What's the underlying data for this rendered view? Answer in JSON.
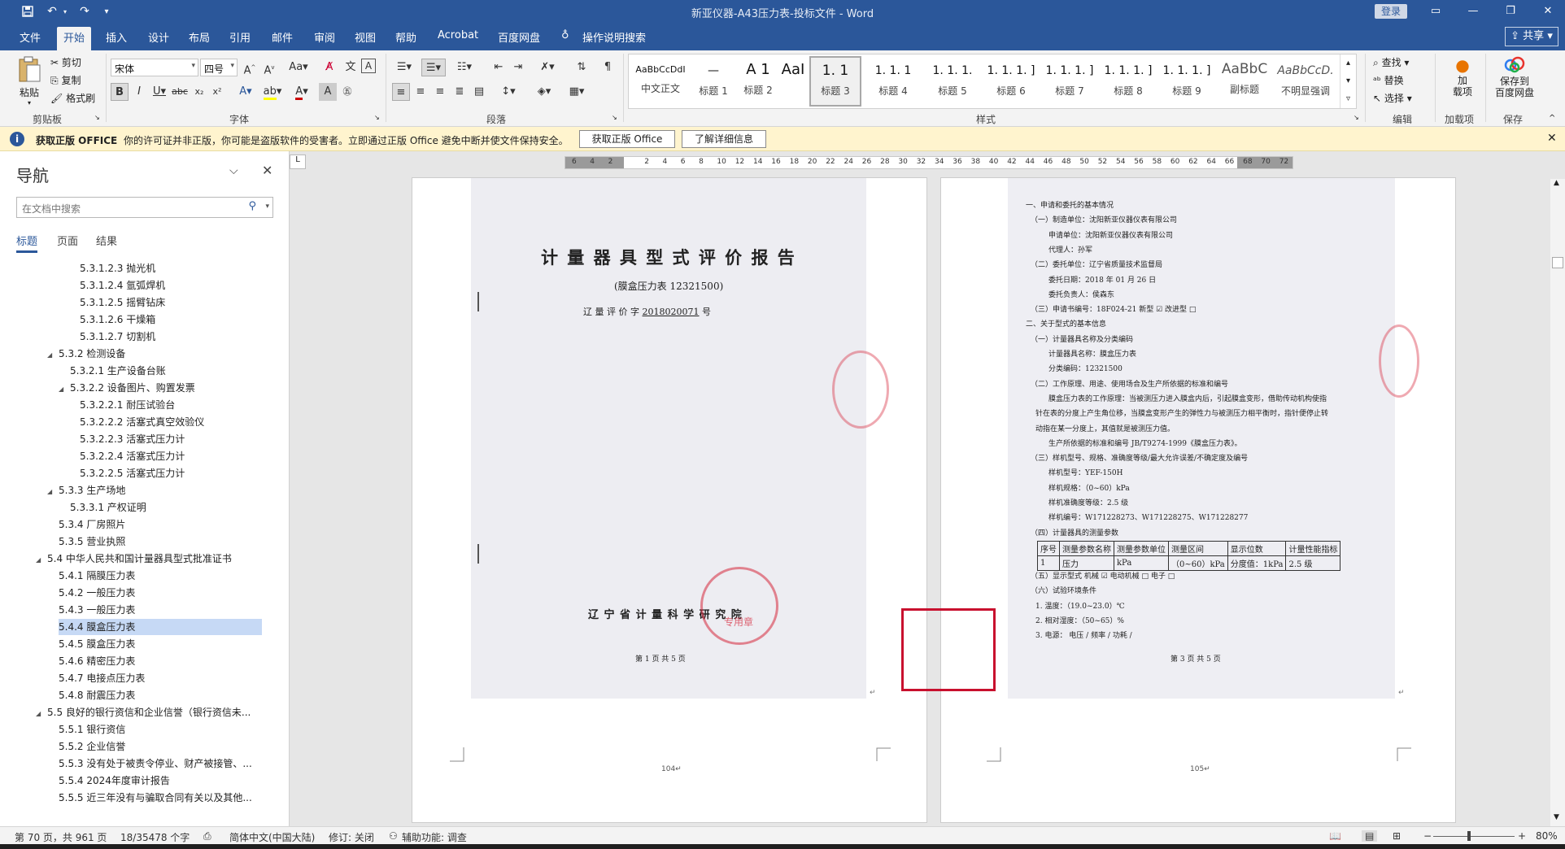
{
  "window": {
    "title": "新亚仪器-A43压力表-投标文件  -  Word",
    "login": "登录",
    "share": "共享"
  },
  "menu": [
    "文件",
    "开始",
    "插入",
    "设计",
    "布局",
    "引用",
    "邮件",
    "审阅",
    "视图",
    "帮助",
    "Acrobat",
    "百度网盘",
    "操作说明搜索"
  ],
  "ribbon": {
    "clipboard": {
      "paste": "粘贴",
      "cut": "剪切",
      "copy": "复制",
      "painter": "格式刷",
      "label": "剪贴板"
    },
    "font": {
      "name": "宋体",
      "size": "四号",
      "label": "字体"
    },
    "paragraph": {
      "label": "段落"
    },
    "styles": {
      "label": "样式",
      "items": [
        {
          "sample": "AaBbCcDdI",
          "name": "中文正文"
        },
        {
          "sample": "—",
          "name": "标题 1"
        },
        {
          "sample": "A  1",
          "name": "标题 2"
        },
        {
          "sample": "AaI",
          "name": ""
        },
        {
          "sample": "1. 1",
          "name": "标题 3"
        },
        {
          "sample": "1. 1. 1",
          "name": "标题 4"
        },
        {
          "sample": "1. 1. 1.",
          "name": "标题 5"
        },
        {
          "sample": "1. 1. 1. ]",
          "name": "标题 6"
        },
        {
          "sample": "1. 1. 1. ]",
          "name": "标题 7"
        },
        {
          "sample": "1. 1. 1. ]",
          "name": "标题 8"
        },
        {
          "sample": "1. 1. 1. ]",
          "name": "标题 9"
        },
        {
          "sample": "AaBbC",
          "name": "副标题"
        },
        {
          "sample": "AaBbCcD.",
          "name": "不明显强调"
        }
      ]
    },
    "editing": {
      "find": "查找",
      "replace": "替换",
      "select": "选择",
      "label": "编辑"
    },
    "addins": {
      "btn": "加\n载项",
      "label": "加载项"
    },
    "save": {
      "btn1": "保存到",
      "btn2": "百度网盘",
      "label": "保存"
    }
  },
  "infobar": {
    "title": "获取正版 OFFICE",
    "message": "你的许可证并非正版，你可能是盗版软件的受害者。立即通过正版 Office 避免中断并使文件保持安全。",
    "btn1": "获取正版 Office",
    "btn2": "了解详细信息"
  },
  "nav": {
    "title": "导航",
    "search_placeholder": "在文档中搜索",
    "tabs": [
      "标题",
      "页面",
      "结果"
    ],
    "items": [
      {
        "text": "5.3.1.2.3 抛光机",
        "level": 4
      },
      {
        "text": "5.3.1.2.4 氩弧焊机",
        "level": 4
      },
      {
        "text": "5.3.1.2.5 摇臂钻床",
        "level": 4
      },
      {
        "text": "5.3.1.2.6 干燥箱",
        "level": 4
      },
      {
        "text": "5.3.1.2.7 切割机",
        "level": 4
      },
      {
        "text": "5.3.2 检测设备",
        "level": 2,
        "expand": true
      },
      {
        "text": "5.3.2.1 生产设备台账",
        "level": 3
      },
      {
        "text": "5.3.2.2 设备图片、购置发票",
        "level": 3,
        "expand": true
      },
      {
        "text": "5.3.2.2.1 耐压试验台",
        "level": 4
      },
      {
        "text": "5.3.2.2.2 活塞式真空效验仪",
        "level": 4
      },
      {
        "text": "5.3.2.2.3 活塞式压力计",
        "level": 4
      },
      {
        "text": "5.3.2.2.4 活塞式压力计",
        "level": 4
      },
      {
        "text": "5.3.2.2.5 活塞式压力计",
        "level": 4
      },
      {
        "text": "5.3.3 生产场地",
        "level": 2,
        "expand": true
      },
      {
        "text": "5.3.3.1 产权证明",
        "level": 3
      },
      {
        "text": "5.3.4 厂房照片",
        "level": 2
      },
      {
        "text": "5.3.5 营业执照",
        "level": 2
      },
      {
        "text": "5.4 中华人民共和国计量器具型式批准证书",
        "level": 1,
        "expand": true
      },
      {
        "text": "5.4.1 隔膜压力表",
        "level": 2
      },
      {
        "text": "5.4.2 一般压力表",
        "level": 2
      },
      {
        "text": "5.4.3 一般压力表",
        "level": 2
      },
      {
        "text": "5.4.4 膜盒压力表",
        "level": 2,
        "selected": true
      },
      {
        "text": "5.4.5 膜盒压力表",
        "level": 2
      },
      {
        "text": "5.4.6 精密压力表",
        "level": 2
      },
      {
        "text": "5.4.7 电接点压力表",
        "level": 2
      },
      {
        "text": "5.4.8 耐震压力表",
        "level": 2
      },
      {
        "text": "5.5 良好的银行资信和企业信誉（银行资信未...",
        "level": 1,
        "expand": true
      },
      {
        "text": "5.5.1 银行资信",
        "level": 2
      },
      {
        "text": "5.5.2 企业信誉",
        "level": 2
      },
      {
        "text": "5.5.3 没有处于被责令停业、财产被接管、...",
        "level": 2
      },
      {
        "text": "5.5.4 2024年度审计报告",
        "level": 2
      },
      {
        "text": "5.5.5 近三年没有与骗取合同有关以及其他...",
        "level": 2
      }
    ]
  },
  "ruler": [
    "6",
    "4",
    "2",
    "",
    "2",
    "4",
    "6",
    "8",
    "10",
    "12",
    "14",
    "16",
    "18",
    "20",
    "22",
    "24",
    "26",
    "28",
    "30",
    "32",
    "34",
    "36",
    "38",
    "40",
    "42",
    "44",
    "46",
    "48",
    "50",
    "52",
    "54",
    "56",
    "58",
    "60",
    "62",
    "64",
    "66",
    "68",
    "70",
    "72"
  ],
  "page1": {
    "title": "计 量 器 具 型 式 评 价 报 告",
    "subtitle": "(膜盒压力表 12321500)",
    "num_prefix": "辽  量  评  价  字",
    "num": "2018020071",
    "num_suffix": "号",
    "institute": "辽 宁 省 计 量 科 学 研 究 院",
    "footer": "第 1 页  共 5 页",
    "page_number": "104↵",
    "stamp_text": "专用章"
  },
  "page2": {
    "lines": [
      "一、申请和委托的基本情况",
      "（一）制造单位：沈阳新亚仪器仪表有限公司",
      "申请单位：沈阳新亚仪器仪表有限公司",
      "代理人：孙军",
      "（二）委托单位：辽宁省质量技术监督局",
      "委托日期：2018 年 01 月 26 日",
      "委托负责人：侯森东",
      "（三）申请书编号：18F024-21          新型  ☑         改进型   □",
      "二、关于型式的基本信息",
      "（一）计量器具名称及分类编码",
      "计量器具名称：膜盒压力表",
      "分类编码：12321500",
      "（二）工作原理、用途、使用场合及生产所依据的标准和编号",
      "膜盒压力表的工作原理：当被测压力进入膜盒内后，引起膜盒变形，借助传动机构使指",
      "针在表的分度上产生角位移，当膜盒变形产生的弹性力与被测压力相平衡时，指针便停止转",
      "动指在某一分度上，其值就是被测压力值。",
      "生产所依据的标准和编号 JB/T9274-1999《膜盒压力表》。",
      "（三）样机型号、规格、准确度等级/最大允许误差/不确定度及编号",
      "样机型号：YEF-150H",
      "样机规格：（0~60）kPa",
      "样机准确度等级：2.5 级",
      "样机编号：W171228273、W171228275、W171228277",
      "（四）计量器具的测量参数"
    ],
    "table_head": [
      "序号",
      "测量参数名称",
      "测量参数单位",
      "测量区间",
      "显示位数",
      "计量性能指标"
    ],
    "table_row": [
      "1",
      "压力",
      "kPa",
      "（0~60）kPa",
      "分度值：1kPa",
      "2.5 级"
    ],
    "lines2": [
      "（五）显示型式      机械  ☑      电动机械  □       电子  □",
      "（六）试验环境条件",
      "1. 温度：（19.0~23.0）℃",
      "2. 相对湿度：（50~65）%",
      "3. 电源：               电压   /            频率   /              功耗   /"
    ],
    "footer": "第 3 页  共 5 页",
    "page_number": "105↵"
  },
  "status": {
    "page": "第 70 页，共 961 页",
    "words": "18/35478 个字",
    "lang": "简体中文(中国大陆)",
    "track": "修订: 关闭",
    "access": "辅助功能: 调查",
    "zoom": "80%"
  },
  "colors": {
    "brand": "#2b579a",
    "info": "#fff4ce",
    "highlight": "#c8102e"
  }
}
